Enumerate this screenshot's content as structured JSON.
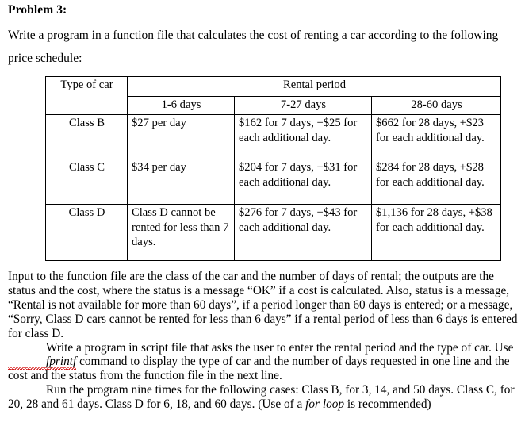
{
  "document": {
    "heading": "Problem 3:",
    "intro": "Write a program in a function file that calculates the cost of renting a car according to the following price schedule:"
  },
  "table": {
    "header_type_of_car": "Type of car",
    "header_rental_period": "Rental period",
    "subheaders": [
      "1-6 days",
      "7-27 days",
      "28-60 days"
    ],
    "rows": [
      {
        "type": "Class B",
        "days_1_6": "$27 per day",
        "days_7_27": "$162 for 7 days, +$25 for each additional day.",
        "days_28_60": "$662 for 28 days, +$23 for each additional day."
      },
      {
        "type": "Class C",
        "days_1_6": "$34 per day",
        "days_7_27": "$204 for 7 days, +$31 for each additional day.",
        "days_28_60": "$284 for 28 days, +$28 for each additional day."
      },
      {
        "type": "Class D",
        "days_1_6": "Class D cannot be rented for less than 7 days.",
        "days_7_27": "$276 for 7 days, +$43 for each additional day.",
        "days_28_60": "$1,136 for 28 days, +$38 for each additional day."
      }
    ]
  },
  "body": {
    "paragraph1": "Input to the function file are the class of the car and the number of days of rental; the outputs are the status and the cost, where the status is a message “OK” if a cost is calculated. Also, status is a message, “Rental is not available for more than 60 days”, if a period longer than 60 days is entered; or a message, “Sorry, Class D cars cannot be rented for less than 6 days” if a rental period of less than 6 days is entered for class D.",
    "paragraph2_part1": "Write a program in script file that asks the user to enter the rental period and the type of car. Use ",
    "paragraph2_command": "fprintf",
    "paragraph2_part2": " command to display the type of car and the number of days requested in one line and the cost and the status from the function file in the next line.",
    "paragraph3_part1": "Run the program nine times for the following cases: Class B, for 3, 14, and 50 days. Class C, for 20, 28 and 61 days. Class D for 6, 18, and 60 days. (Use of a ",
    "paragraph3_italic": "for loop",
    "paragraph3_part2": " is recommended)"
  },
  "colors": {
    "text": "#000000",
    "background": "#ffffff",
    "border": "#000000",
    "spellcheck_underline": "#d82020"
  }
}
